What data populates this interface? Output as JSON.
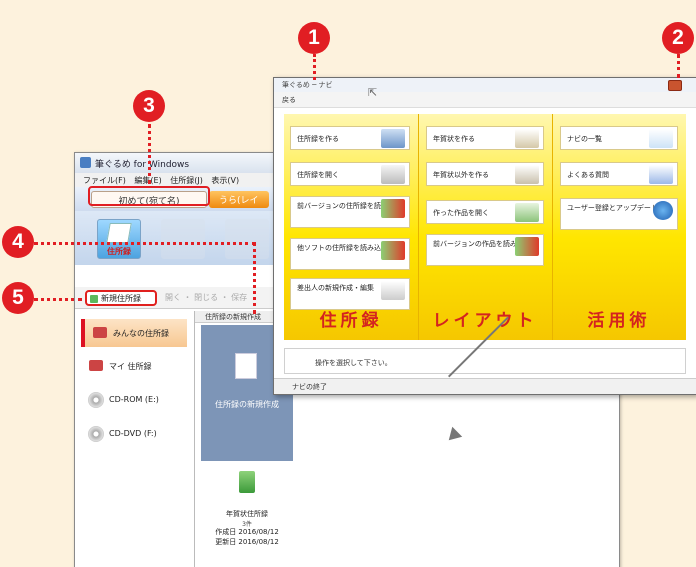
{
  "back_window": {
    "title": "筆ぐるめ for Windows",
    "menu": [
      "ファイル(F)",
      "編集(E)",
      "住所録(J)",
      "表示(V)"
    ],
    "tab_hajimete": "初めて(宛て名)",
    "tab_orange": "うら(レイ",
    "ribbon": {
      "jushoroku": "住所録"
    },
    "toolbar": {
      "new_addressbook": "新規住所録",
      "rest": "開く ・ 閉じる ・ 保存"
    },
    "sidebar": [
      {
        "label": "みんなの住所録"
      },
      {
        "label": "マイ 住所録"
      },
      {
        "label": "CD-ROM (E:)"
      },
      {
        "label": "CD-DVD (F:)"
      }
    ],
    "content": {
      "header": "住所録の新規作成",
      "selected_card": "住所録の新規作成",
      "nenga_title": "年賀状住所録",
      "nenga_count": "3件",
      "created": "作成日 2016/08/12",
      "updated": "更新日 2016/08/12"
    }
  },
  "front_window": {
    "title": "筆ぐるめ ─ ナビ",
    "toolbar": "戻る",
    "close_label": "×",
    "columns": [
      {
        "category": "住所録",
        "items": [
          "住所録を作る",
          "住所録を開く",
          "前バージョンの住所録を読み込む",
          "他ソフトの住所録を読み込む",
          "差出人の新規作成・編集"
        ]
      },
      {
        "category": "レイアウト",
        "items": [
          "年賀状を作る",
          "年賀状以外を作る",
          "作った作品を開く",
          "前バージョンの作品を読み込む"
        ]
      },
      {
        "category": "活用術",
        "items": [
          "ナビの一覧",
          "よくある質問",
          "ユーザー登録とアップデート"
        ]
      }
    ],
    "message": "操作を選択して下さい。",
    "status": "ナビの終了"
  },
  "markers": [
    "1",
    "2",
    "3",
    "4",
    "5"
  ],
  "colors": {
    "marker": "#e11e23",
    "panel_yellow": "#ffe600",
    "category_red": "#d4241f"
  }
}
